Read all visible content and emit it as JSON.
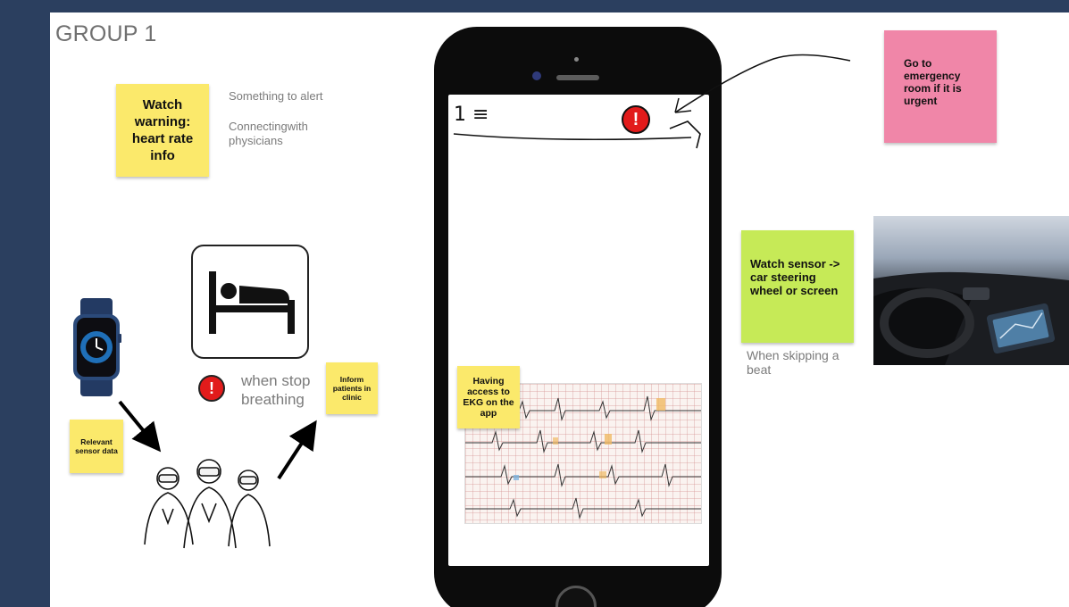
{
  "board": {
    "group_title": "GROUP 1"
  },
  "notes": {
    "watch_warning": "Watch warning: heart rate info",
    "something_to_alert": "Something to alert",
    "connecting": "Connectingwith physicians",
    "relevant_sensor": "Relevant sensor data",
    "inform_patients": "Inform patients in clinic",
    "when_stop_breathing": "when stop breathing",
    "having_access": "Having access to EKG on the app",
    "go_to_emergency": "Go to emergency room if it is urgent",
    "watch_sensor": "Watch sensor -> car steering wheel or screen",
    "when_skipping": "When skipping a beat"
  },
  "phone": {
    "menu_sketch": "1 ≡",
    "alert_glyph": "!"
  },
  "icons": {
    "alert": "exclamation-circle-icon",
    "bed": "bed-icon",
    "watch": "smartwatch-icon",
    "doctors": "doctors-group-icon",
    "car": "car-interior-photo"
  },
  "colors": {
    "background": "#2b3f5f",
    "sticky_yellow": "#fbe96b",
    "sticky_pink": "#f086a8",
    "sticky_green": "#c6ea57",
    "alert_red": "#e21b1b"
  }
}
